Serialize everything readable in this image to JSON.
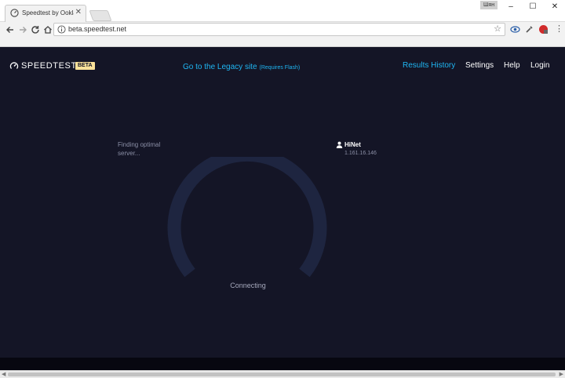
{
  "browser": {
    "tab_title": "Speedtest by Ookla - T…",
    "tab_close": "✕",
    "user_badge": "Шян",
    "window_controls": {
      "minimize": "–",
      "maximize": "☐",
      "close": "✕"
    },
    "url": "beta.speedtest.net",
    "star": "☆",
    "menu": "⋮"
  },
  "header": {
    "logo_text": "SPEEDTEST",
    "beta_badge": "BETA",
    "legacy_link": "Go to the Legacy site",
    "legacy_note": "(Requires Flash)",
    "nav": {
      "results_history": "Results History",
      "settings": "Settings",
      "help": "Help",
      "login": "Login"
    }
  },
  "main": {
    "finding_text": "Finding optimal server...",
    "isp_name": "HiNet",
    "isp_ip": "1.161.16.146",
    "status": "Connecting"
  },
  "colors": {
    "page_bg": "#141526",
    "accent": "#1fb6f3",
    "gauge_track": "#1e2540",
    "beta_badge_bg": "#fbe29a"
  },
  "scrollbar": {
    "left_arrow": "◀",
    "right_arrow": "▶"
  }
}
